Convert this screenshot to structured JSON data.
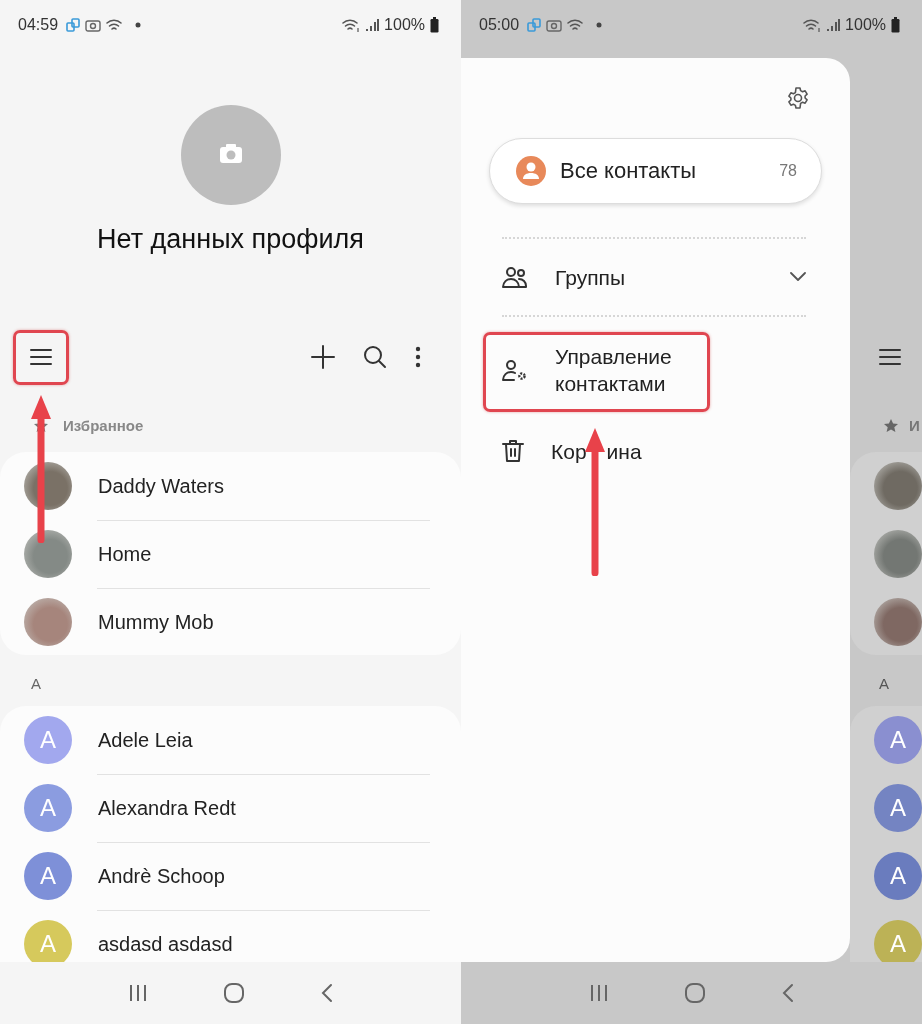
{
  "screens": [
    {
      "kind": "contacts",
      "status_bar": {
        "time": "04:59",
        "battery": "100%"
      },
      "profile": {
        "title": "Нет данных профиля"
      },
      "favorites": {
        "label": "Избранное",
        "contacts": [
          {
            "name": "Daddy Waters",
            "color": "#7a7166"
          },
          {
            "name": "Home",
            "color": "#848a86"
          },
          {
            "name": "Mummy Mob",
            "color": "#a6857c"
          }
        ]
      },
      "sections": [
        {
          "letter": "A",
          "contacts": [
            {
              "name": "Adele Leia",
              "initial": "A",
              "color": "#a2a8ee"
            },
            {
              "name": "Alexandra Redt",
              "initial": "A",
              "color": "#8b9ce0"
            },
            {
              "name": "Andrè Schoop",
              "initial": "A",
              "color": "#7e90d8"
            },
            {
              "name": "asdasd asdasd",
              "initial": "A",
              "color": "#d6c95c"
            }
          ]
        }
      ]
    },
    {
      "kind": "drawer",
      "status_bar": {
        "time": "05:00",
        "battery": "100%"
      },
      "all_contacts": {
        "label": "Все контакты",
        "count": "78"
      },
      "menu": [
        {
          "kind": "groups",
          "label": "Группы"
        },
        {
          "kind": "manage",
          "label": "Управление контактами"
        },
        {
          "kind": "trash",
          "label_parts": [
            "Кор",
            "ина"
          ]
        }
      ],
      "background_list": {
        "favorites_label": "И",
        "favorites": [
          {
            "color": "#6f6a62"
          },
          {
            "color": "#737773"
          },
          {
            "color": "#7f6862"
          }
        ],
        "section_letter": "A",
        "avatars": [
          {
            "initial": "A",
            "color": "#8a8fd0"
          },
          {
            "initial": "A",
            "color": "#7484c2"
          },
          {
            "initial": "A",
            "color": "#6a7cbe"
          },
          {
            "initial": "A",
            "color": "#bcb256"
          }
        ]
      }
    }
  ]
}
